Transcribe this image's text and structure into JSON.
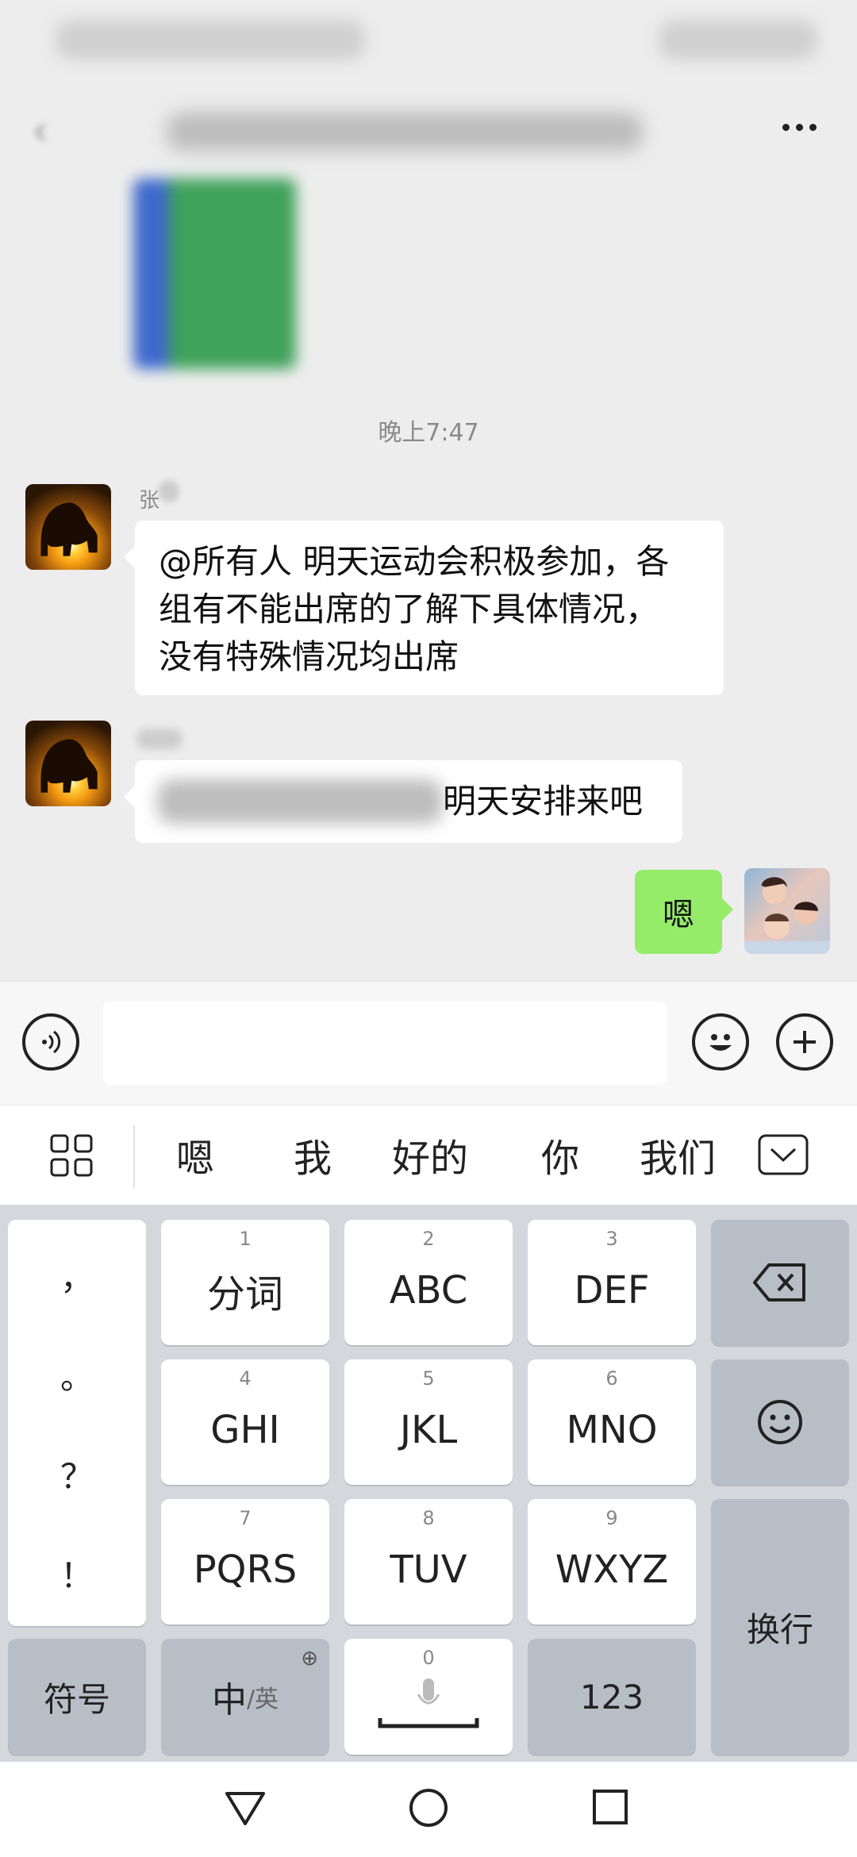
{
  "header": {
    "more_label": "..."
  },
  "chat": {
    "timestamp": "晚上7:47",
    "messages": [
      {
        "sender": "张",
        "text_lines": [
          "@所有人 明天运动会积极参加，各",
          "组有不能出席的了解下具体情况，",
          "没有特殊情况均出席"
        ]
      },
      {
        "sender": "",
        "text_visible": "明天安排来吧"
      }
    ],
    "my_message": "嗯"
  },
  "input_bar": {
    "voice_icon": "voice-icon",
    "emoji_icon": "emoji-icon",
    "plus_icon": "plus-icon"
  },
  "suggestions": [
    "嗯",
    "我",
    "好的",
    "你",
    "我们"
  ],
  "keyboard": {
    "punctuation": [
      "，",
      "。",
      "？",
      "！"
    ],
    "keys": [
      {
        "num": "1",
        "label": "分词"
      },
      {
        "num": "2",
        "label": "ABC"
      },
      {
        "num": "3",
        "label": "DEF"
      },
      {
        "num": "4",
        "label": "GHI"
      },
      {
        "num": "5",
        "label": "JKL"
      },
      {
        "num": "6",
        "label": "MNO"
      },
      {
        "num": "7",
        "label": "PQRS"
      },
      {
        "num": "8",
        "label": "TUV"
      },
      {
        "num": "9",
        "label": "WXYZ"
      }
    ],
    "symbols_label": "符号",
    "lang_main": "中",
    "lang_alt": "/英",
    "space_num": "0",
    "num_label": "123",
    "enter_label": "换行"
  },
  "colors": {
    "bg": "#ededed",
    "my_bubble": "#95ec69",
    "keyboard_bg": "#d4d7dc"
  }
}
